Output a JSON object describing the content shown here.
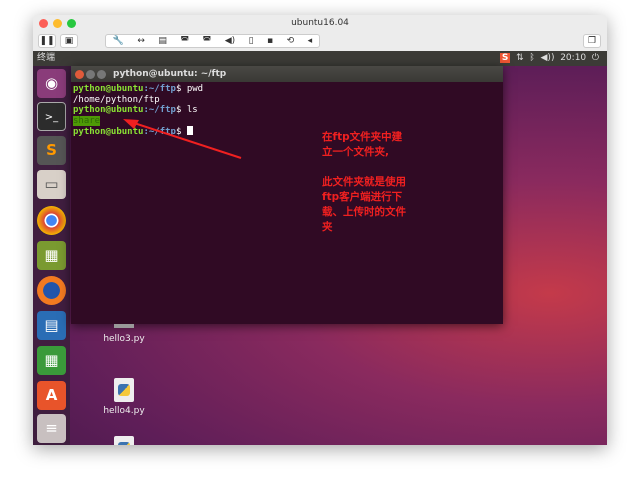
{
  "window": {
    "title": "ubuntu16.04"
  },
  "toolbar": {
    "icons": [
      "pause-icon",
      "snapshot-icon",
      "wrench-icon",
      "resize-icon",
      "disk-icon",
      "hdd-icon",
      "hdd2-icon",
      "volume-icon",
      "usb-icon",
      "save-icon",
      "sync-icon",
      "chevron-left-icon",
      "restore-icon"
    ]
  },
  "topbar": {
    "app_name": "终端",
    "time": "20:10"
  },
  "terminal": {
    "title": "python@ubuntu: ~/ftp",
    "prompt_user": "python@ubuntu",
    "prompt_path": ":~/ftp",
    "lines": [
      {
        "cmd": "pwd"
      },
      {
        "out": "/home/python/ftp"
      },
      {
        "cmd": "ls"
      },
      {
        "dir": "share"
      },
      {
        "cmd": ""
      }
    ]
  },
  "annotation": {
    "text1": "在ftp文件夹中建立一个文件夹,",
    "text2": "此文件夹就是使用ftp客户端进行下载、上传时的文件夹",
    "color": "#f02020"
  },
  "desktop": {
    "files": [
      "hello3.py",
      "hello4.py"
    ]
  }
}
